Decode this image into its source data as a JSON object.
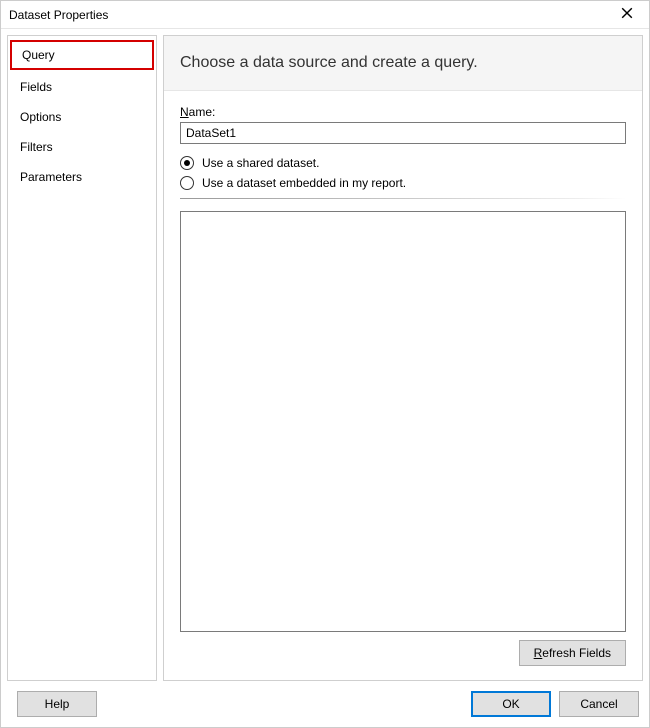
{
  "window": {
    "title": "Dataset Properties"
  },
  "sidebar": {
    "items": [
      {
        "label": "Query",
        "selected": true
      },
      {
        "label": "Fields",
        "selected": false
      },
      {
        "label": "Options",
        "selected": false
      },
      {
        "label": "Filters",
        "selected": false
      },
      {
        "label": "Parameters",
        "selected": false
      }
    ]
  },
  "main": {
    "heading": "Choose a data source and create a query.",
    "name_label": "Name:",
    "name_value": "DataSet1",
    "radio_shared": "Use a shared dataset.",
    "radio_embedded": "Use a dataset embedded in my report.",
    "radio_selected": "shared",
    "query_value": "",
    "refresh_label": "Refresh Fields"
  },
  "footer": {
    "help": "Help",
    "ok": "OK",
    "cancel": "Cancel"
  }
}
